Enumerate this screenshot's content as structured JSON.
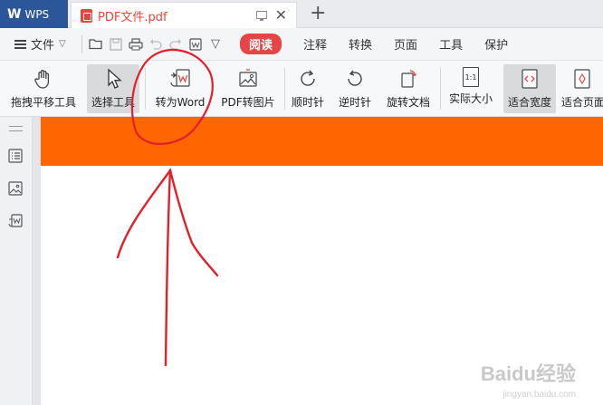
{
  "titlebar": {
    "app_name": "WPS",
    "logo_glyph": "W",
    "doc_title": "PDF文件.pdf",
    "close_glyph": "✕",
    "new_tab_glyph": "+"
  },
  "menubar": {
    "file_label": "文件",
    "file_chevron": "▽",
    "more_chevron": "▽",
    "tabs": [
      {
        "label": "阅读",
        "active": true
      },
      {
        "label": "注释"
      },
      {
        "label": "转换"
      },
      {
        "label": "页面"
      },
      {
        "label": "工具"
      },
      {
        "label": "保护"
      }
    ]
  },
  "ribbon": {
    "items": [
      {
        "label": "拖拽平移工具",
        "icon": "hand-icon"
      },
      {
        "label": "选择工具",
        "icon": "cursor-icon",
        "selected": true
      },
      {
        "label": "转为Word",
        "icon": "pdf-to-word-icon"
      },
      {
        "label": "PDF转图片",
        "icon": "pdf-to-image-icon"
      },
      {
        "label": "顺时针",
        "icon": "rotate-cw-icon"
      },
      {
        "label": "逆时针",
        "icon": "rotate-ccw-icon"
      },
      {
        "label": "旋转文档",
        "icon": "rotate-doc-icon"
      },
      {
        "label": "实际大小",
        "icon": "actual-size-icon",
        "icon_text": "1:1"
      },
      {
        "label": "适合宽度",
        "icon": "fit-width-icon",
        "selected": true
      },
      {
        "label": "适合页面",
        "icon": "fit-page-icon"
      }
    ]
  },
  "sidebar": {
    "icons": [
      "outline-icon",
      "thumbnail-icon",
      "convert-icon"
    ]
  },
  "watermark": {
    "text": "Baidu经验",
    "sub": "jingyan.baidu.com"
  },
  "colors": {
    "brand_blue": "#2b579a",
    "accent_red": "#e54545",
    "orange_banner": "#ff6600",
    "annotation_red": "#e0202a"
  }
}
